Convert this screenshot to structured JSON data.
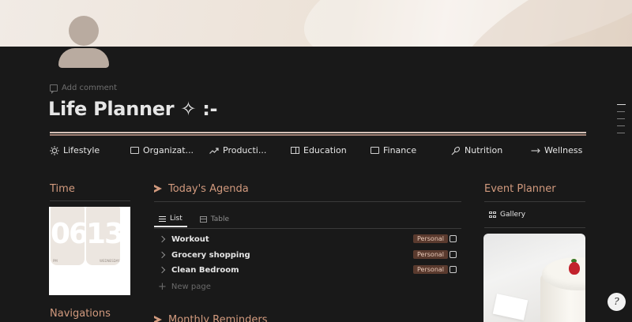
{
  "page": {
    "add_comment": "Add comment",
    "title": "Life Planner ✧ :-"
  },
  "nav": [
    {
      "label": "Lifestyle",
      "icon": "sun-icon"
    },
    {
      "label": "Organizat...",
      "icon": "folder-icon"
    },
    {
      "label": "Producti...",
      "icon": "trend-up-icon"
    },
    {
      "label": "Education",
      "icon": "book-icon"
    },
    {
      "label": "Finance",
      "icon": "folder-icon"
    },
    {
      "label": "Nutrition",
      "icon": "utensil-icon"
    },
    {
      "label": "Wellness",
      "icon": "arrows-icon"
    }
  ],
  "time": {
    "title": "Time",
    "clock": {
      "hour": "06",
      "minute": "13",
      "hour_caption": "PM",
      "minute_caption": "WEDNESDAY"
    }
  },
  "navigations": {
    "title": "Navigations"
  },
  "agenda": {
    "title": "Today's Agenda",
    "tabs": [
      {
        "label": "List",
        "active": true
      },
      {
        "label": "Table",
        "active": false
      }
    ],
    "tasks": [
      {
        "name": "Workout",
        "tag": "Personal",
        "done": false
      },
      {
        "name": "Grocery shopping",
        "tag": "Personal",
        "done": false
      },
      {
        "name": "Clean Bedroom",
        "tag": "Personal",
        "done": false
      }
    ],
    "new_page": "New page"
  },
  "monthly": {
    "title": "Monthly Reminders"
  },
  "events": {
    "title": "Event Planner",
    "view": "Gallery"
  },
  "help": {
    "glyph": "?"
  },
  "colors": {
    "background": "#191919",
    "accent": "#d29a7e",
    "tag_bg": "#5a3a2e",
    "tag_text": "#e8c9b8"
  }
}
